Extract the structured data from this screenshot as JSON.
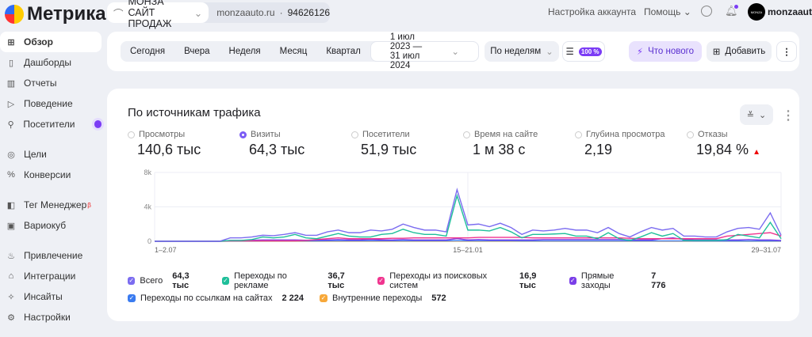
{
  "header": {
    "logo": "Метрика",
    "counter_name": "МОНЗА САЙТ ПРОДАЖ",
    "domain": "monzaauto.ru",
    "counter_id": "94626126",
    "account_settings": "Настройка аккаунта",
    "help": "Помощь",
    "user": "monzaauto",
    "avatar_text": "MONZA"
  },
  "sidebar": {
    "items": [
      {
        "label": "Обзор",
        "icon": "grid-icon"
      },
      {
        "label": "Дашборды",
        "icon": "dashboard-icon"
      },
      {
        "label": "Отчеты",
        "icon": "bar-chart-icon"
      },
      {
        "label": "Поведение",
        "icon": "play-icon"
      },
      {
        "label": "Посетители",
        "icon": "user-icon"
      },
      {
        "label": "Цели",
        "icon": "target-icon"
      },
      {
        "label": "Конверсии",
        "icon": "percent-icon"
      },
      {
        "label": "Тег Менеджер",
        "icon": "tag-icon",
        "badge": "β"
      },
      {
        "label": "Вариокуб",
        "icon": "cube-icon"
      },
      {
        "label": "Привлечение",
        "icon": "fire-icon"
      },
      {
        "label": "Интеграции",
        "icon": "puzzle-icon"
      },
      {
        "label": "Инсайты",
        "icon": "sparkle-icon"
      },
      {
        "label": "Настройки",
        "icon": "gear-icon"
      }
    ]
  },
  "toolbar": {
    "periods": [
      "Сегодня",
      "Вчера",
      "Неделя",
      "Месяц",
      "Квартал"
    ],
    "date_range": "1 июл 2023 — 31 июл 2024",
    "grouping": "По неделям",
    "sampling": "100 %",
    "whats_new": "Что нового",
    "add": "Добавить"
  },
  "widget": {
    "title": "По источникам трафика",
    "metrics": [
      {
        "label": "Просмотры",
        "value": "140,6 тыс",
        "selected": false
      },
      {
        "label": "Визиты",
        "value": "64,3 тыс",
        "selected": true
      },
      {
        "label": "Посетители",
        "value": "51,9 тыс",
        "selected": false
      },
      {
        "label": "Время на сайте",
        "value": "1 м 38 с",
        "selected": false
      },
      {
        "label": "Глубина просмотра",
        "value": "2,19",
        "selected": false
      },
      {
        "label": "Отказы",
        "value": "19,84 %",
        "selected": false,
        "trend": "up"
      }
    ]
  },
  "chart_data": {
    "type": "line",
    "ylim": [
      0,
      8000
    ],
    "yticks": [
      "0",
      "4k",
      "8k"
    ],
    "xtick_labels": [
      {
        "index": 0,
        "label": "1–2.07"
      },
      {
        "index": 29,
        "label": "15–21.01"
      },
      {
        "index": 58,
        "label": "29–31.07"
      }
    ],
    "grid": true,
    "series": [
      {
        "name": "Всего",
        "total": "64,3 тыс",
        "color": "#7b6cf0",
        "values": [
          0,
          0,
          0,
          0,
          0,
          0,
          0,
          400,
          400,
          500,
          700,
          650,
          800,
          1000,
          700,
          700,
          1100,
          1300,
          1000,
          1000,
          1300,
          1200,
          1400,
          2000,
          1600,
          1300,
          1300,
          1100,
          6000,
          1900,
          2000,
          1700,
          2100,
          1600,
          800,
          1300,
          1200,
          1300,
          1500,
          1300,
          1300,
          1000,
          1600,
          900,
          500,
          1100,
          1600,
          1300,
          1500,
          600,
          600,
          500,
          500,
          1100,
          1500,
          1600,
          1400,
          3300,
          700
        ]
      },
      {
        "name": "Переходы по рекламе",
        "total": "36,7 тыс",
        "color": "#1fbf9a",
        "values": [
          0,
          0,
          0,
          0,
          0,
          0,
          0,
          100,
          100,
          200,
          500,
          400,
          500,
          800,
          400,
          300,
          600,
          900,
          600,
          500,
          500,
          800,
          900,
          1400,
          1000,
          800,
          800,
          600,
          5300,
          1300,
          1300,
          1200,
          1600,
          1100,
          400,
          800,
          800,
          850,
          900,
          600,
          600,
          300,
          1000,
          300,
          100,
          500,
          1000,
          600,
          900,
          100,
          100,
          100,
          100,
          200,
          800,
          600,
          400,
          2200,
          300
        ]
      },
      {
        "name": "Переходы из поисковых систем",
        "total": "16,9 тыс",
        "color": "#f0358f",
        "values": [
          0,
          0,
          0,
          0,
          0,
          0,
          0,
          50,
          50,
          50,
          50,
          50,
          50,
          50,
          100,
          200,
          300,
          400,
          300,
          300,
          300,
          300,
          350,
          350,
          400,
          400,
          400,
          400,
          400,
          400,
          450,
          450,
          450,
          450,
          450,
          400,
          400,
          400,
          400,
          400,
          400,
          400,
          400,
          400,
          350,
          300,
          300,
          300,
          300,
          300,
          300,
          300,
          300,
          600,
          700,
          800,
          900,
          1000,
          600
        ]
      },
      {
        "name": "Прямые заходы",
        "total": "7 776",
        "color": "#7a3ee8",
        "values": [
          0,
          0,
          0,
          0,
          0,
          0,
          0,
          100,
          100,
          120,
          150,
          150,
          150,
          150,
          120,
          150,
          150,
          200,
          150,
          150,
          200,
          150,
          150,
          200,
          150,
          150,
          150,
          150,
          300,
          150,
          200,
          150,
          150,
          150,
          150,
          150,
          200,
          200,
          200,
          200,
          200,
          200,
          200,
          200,
          150,
          150,
          150,
          300,
          400,
          200,
          150,
          150,
          150,
          150,
          150,
          200,
          150,
          150,
          100
        ]
      },
      {
        "name": "Переходы по ссылкам на сайтах",
        "total": "2 224",
        "color": "#3a7bf0",
        "values": [
          0,
          0,
          0,
          0,
          0,
          0,
          0,
          30,
          30,
          30,
          40,
          40,
          40,
          40,
          40,
          40,
          50,
          50,
          50,
          50,
          50,
          50,
          50,
          50,
          50,
          50,
          50,
          50,
          60,
          50,
          50,
          50,
          50,
          50,
          40,
          40,
          40,
          40,
          40,
          40,
          40,
          40,
          40,
          40,
          40,
          40,
          40,
          40,
          40,
          40,
          30,
          30,
          30,
          30,
          30,
          30,
          30,
          30,
          30
        ]
      },
      {
        "name": "Внутренние переходы",
        "total": "572",
        "color": "#f7a83a",
        "values": [
          5,
          5,
          5,
          5,
          5,
          5,
          5,
          10,
          10,
          10,
          10,
          10,
          10,
          10,
          10,
          10,
          10,
          10,
          10,
          10,
          10,
          10,
          10,
          10,
          10,
          10,
          10,
          10,
          15,
          10,
          10,
          10,
          10,
          10,
          10,
          10,
          10,
          10,
          10,
          10,
          10,
          10,
          10,
          10,
          10,
          10,
          10,
          10,
          10,
          10,
          10,
          10,
          10,
          10,
          10,
          10,
          10,
          10,
          10
        ]
      }
    ]
  }
}
